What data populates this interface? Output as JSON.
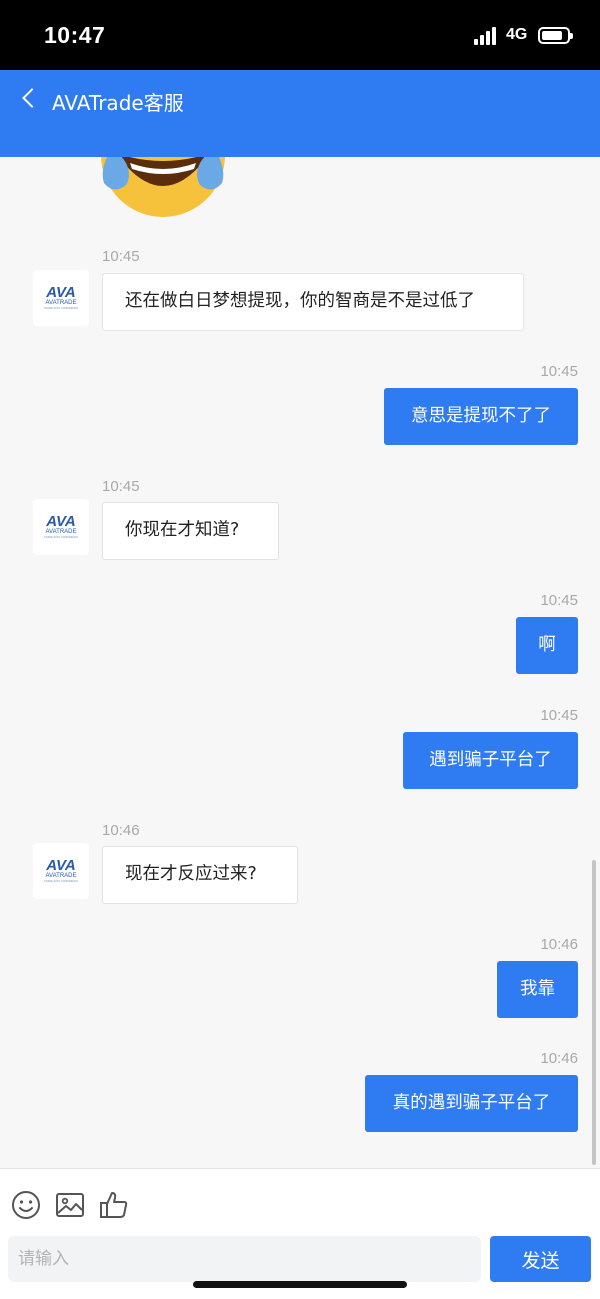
{
  "status_bar": {
    "time": "10:47",
    "network": "4G",
    "battery_level": 0.85
  },
  "header": {
    "title": "AVATrade客服"
  },
  "colors": {
    "accent": "#2f7bf2",
    "incoming_bubble": "#ffffff",
    "outgoing_text": "#ffffff"
  },
  "messages": [
    {
      "time": "10:45",
      "text": "还在做白日梦想提现，你的智商是不是过低了",
      "direction": "in"
    },
    {
      "time": "10:45",
      "text": "意思是提现不了了",
      "direction": "out"
    },
    {
      "time": "10:45",
      "text": "你现在才知道?",
      "direction": "in"
    },
    {
      "time": "10:45",
      "text": "啊",
      "direction": "out"
    },
    {
      "time": "10:45",
      "text": "遇到骗子平台了",
      "direction": "out"
    },
    {
      "time": "10:46",
      "text": "现在才反应过来?",
      "direction": "in"
    },
    {
      "time": "10:46",
      "text": "我靠",
      "direction": "out"
    },
    {
      "time": "10:46",
      "text": "真的遇到骗子平台了",
      "direction": "out"
    }
  ],
  "avatar_logo": {
    "brand": "AVA",
    "wordmark": "AVATRADE",
    "tagline": "TRADE WITH CONFIDENCE"
  },
  "toolbar": {
    "icons": [
      "smiley-icon",
      "image-icon",
      "thumbs-up-icon"
    ]
  },
  "composer": {
    "placeholder": "请输入",
    "value": "",
    "send_label": "发送"
  }
}
